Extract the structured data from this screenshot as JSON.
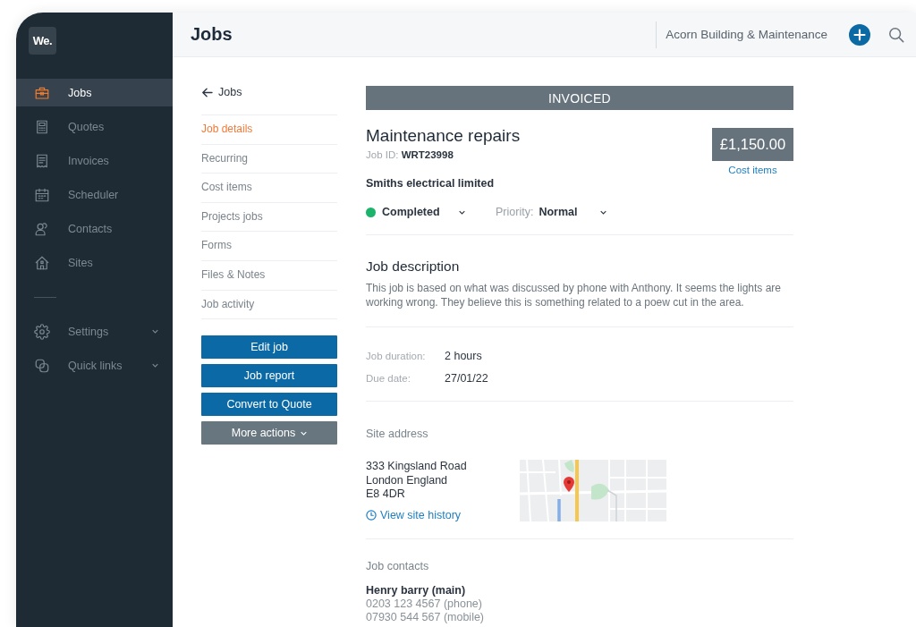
{
  "app": {
    "logo": "We."
  },
  "sidebar": {
    "items": [
      {
        "label": "Jobs",
        "kind": "link",
        "selected": true
      },
      {
        "label": "Quotes",
        "kind": "link",
        "selected": false
      },
      {
        "label": "Invoices",
        "kind": "link",
        "selected": false
      },
      {
        "label": "Scheduler",
        "kind": "link",
        "selected": false
      },
      {
        "label": "Contacts",
        "kind": "link",
        "selected": false
      },
      {
        "label": "Sites",
        "kind": "link",
        "selected": false
      },
      {
        "label": "Settings",
        "kind": "group",
        "selected": false,
        "expanded": false
      },
      {
        "label": "Quick links",
        "kind": "group",
        "selected": false,
        "expanded": false
      }
    ]
  },
  "header": {
    "title": "Jobs",
    "company": "Acorn Building & Maintenance"
  },
  "subnav": {
    "back": "Jobs",
    "items": [
      {
        "label": "Job details",
        "selected": true
      },
      {
        "label": "Recurring",
        "selected": false
      },
      {
        "label": "Cost items",
        "selected": false
      },
      {
        "label": "Projects jobs",
        "selected": false
      },
      {
        "label": "Forms",
        "selected": false
      },
      {
        "label": "Files & Notes",
        "selected": false
      },
      {
        "label": "Job activity",
        "selected": false
      }
    ],
    "actions": [
      {
        "label": "Edit job",
        "kind": "primary"
      },
      {
        "label": "Job report",
        "kind": "primary"
      },
      {
        "label": "Convert to Quote",
        "kind": "primary"
      },
      {
        "label": "More actions",
        "kind": "menu"
      }
    ]
  },
  "job": {
    "banner": "INVOICED",
    "title": "Maintenance repairs",
    "job_id": "Job ID: **WRT23998**",
    "price": "£1,150.00",
    "price_link": "Cost items",
    "customer": "Smiths electrical limited",
    "status": {
      "label": "Completed",
      "color": "#1cb36b"
    },
    "priority": {
      "label": "Priority:",
      "value": "Normal"
    }
  },
  "description": {
    "heading": "Job description",
    "text": "This job is based on what was discussed by phone with Anthony. It seems the lights are working wrong. They believe this is something related to a poew cut in the area."
  },
  "details": [
    {
      "label": "Job duration:",
      "value": "2 hours"
    },
    {
      "label": "Due date:",
      "value": "27/01/22"
    }
  ],
  "site": {
    "heading": "Site address",
    "address": [
      "333 Kingsland Road",
      "London England",
      "E8 4DR"
    ],
    "link": "View site history"
  },
  "contacts": {
    "heading": "Job contacts",
    "items": [
      {
        "name": "Henry barry (main)",
        "lines": [
          "0203 123 4567 (phone)",
          "07930 544 567 (mobile)"
        ]
      }
    ]
  }
}
